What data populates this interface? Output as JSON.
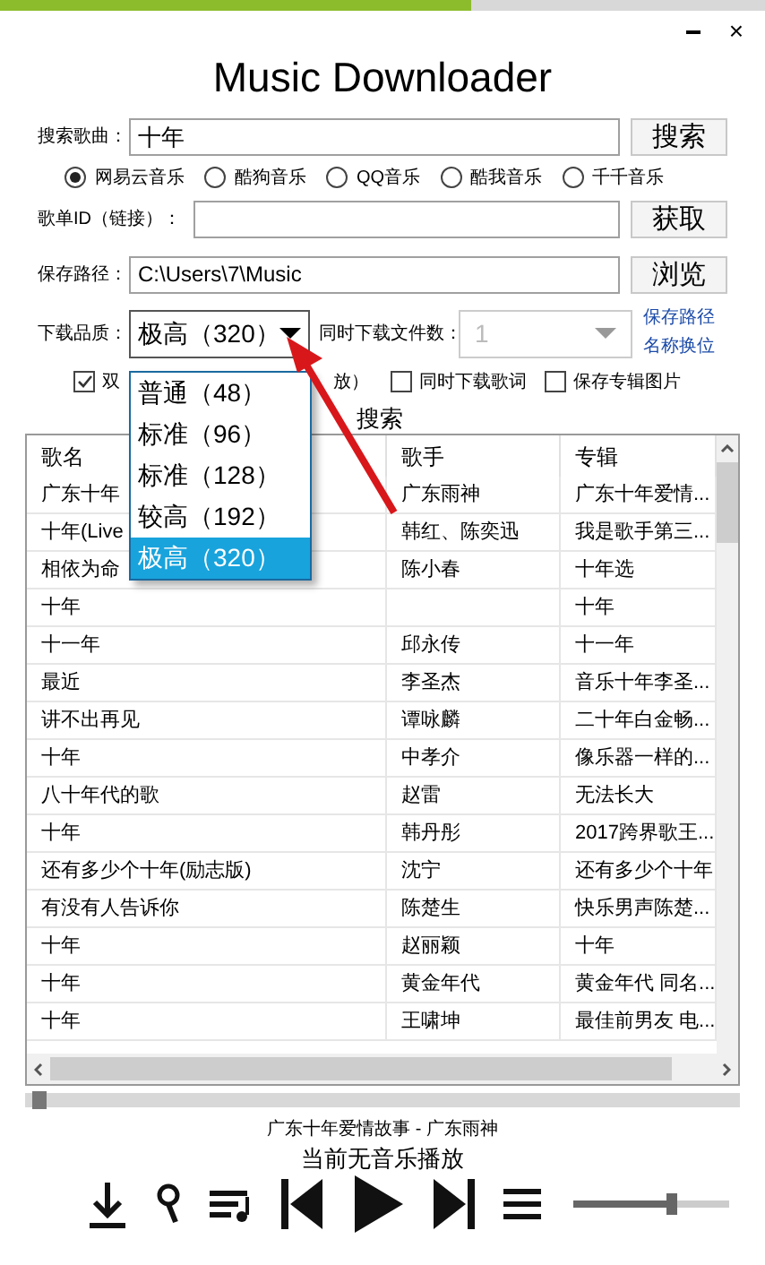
{
  "window": {
    "title": "Music Downloader",
    "controls": [
      "×"
    ]
  },
  "search": {
    "label": "搜索歌曲：",
    "value": "十年",
    "button": "搜索"
  },
  "sources": [
    {
      "label": "网易云音乐",
      "selected": true
    },
    {
      "label": "酷狗音乐",
      "selected": false
    },
    {
      "label": "QQ音乐",
      "selected": false
    },
    {
      "label": "酷我音乐",
      "selected": false
    },
    {
      "label": "千千音乐",
      "selected": false
    }
  ],
  "playlist": {
    "label": "歌单ID（链接）：",
    "button": "获取"
  },
  "save_path": {
    "label": "保存路径：",
    "value": "C:\\Users\\7\\Music",
    "button": "浏览"
  },
  "quality": {
    "label": "下载品质：",
    "value": "极高（320）",
    "options": [
      {
        "label": "普通（48）",
        "selected": false
      },
      {
        "label": "标准（96）",
        "selected": false
      },
      {
        "label": "标准（128）",
        "selected": false
      },
      {
        "label": "较高（192）",
        "selected": false
      },
      {
        "label": "极高（320）",
        "selected": true
      }
    ]
  },
  "concurrent": {
    "label": "同时下载文件数：",
    "value": "1",
    "disabled": true
  },
  "swap_link": [
    "保存路径",
    "名称换位"
  ],
  "options": [
    {
      "label": "双",
      "tail": "放）",
      "checked": true
    },
    {
      "label": "同时下载歌词",
      "checked": false
    },
    {
      "label": "保存专辑图片",
      "checked": false
    }
  ],
  "list_search": "搜索",
  "table": {
    "columns": [
      "歌名",
      "歌手",
      "专辑"
    ],
    "rows": [
      [
        "广东十年",
        "广东雨神",
        "广东十年爱情..."
      ],
      [
        "十年(Live",
        "韩红、陈奕迅",
        "我是歌手第三..."
      ],
      [
        "相依为命",
        "陈小春",
        "十年选"
      ],
      [
        "十年",
        "",
        "十年"
      ],
      [
        "十一年",
        "邱永传",
        "十一年"
      ],
      [
        "最近",
        "李圣杰",
        "音乐十年李圣..."
      ],
      [
        "讲不出再见",
        "谭咏麟",
        "二十年白金畅..."
      ],
      [
        "十年",
        "中孝介",
        "像乐器一样的..."
      ],
      [
        "八十年代的歌",
        "赵雷",
        "无法长大"
      ],
      [
        "十年",
        "韩丹彤",
        "2017跨界歌王..."
      ],
      [
        "还有多少个十年(励志版)",
        "沈宁",
        "还有多少个十年"
      ],
      [
        "有没有人告诉你",
        "陈楚生",
        "快乐男声陈楚..."
      ],
      [
        "十年",
        "赵丽颖",
        "十年"
      ],
      [
        "十年",
        "黄金年代",
        "黄金年代 同名..."
      ],
      [
        "十年",
        "王啸坤",
        "最佳前男友 电..."
      ]
    ]
  },
  "progress": {
    "level": 0.01
  },
  "now_playing": "广东十年爱情故事 - 广东雨神",
  "status": "当前无音乐播放",
  "volume": {
    "level": 0.6
  }
}
